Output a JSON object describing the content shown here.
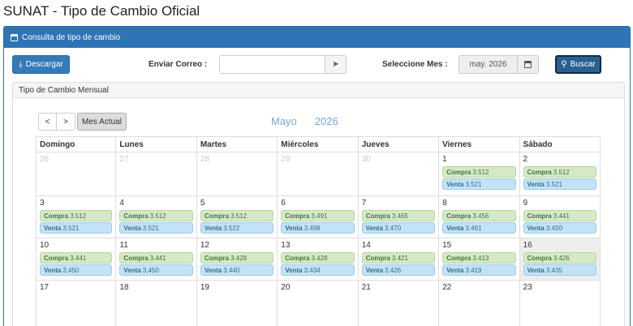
{
  "page_title": "SUNAT - Tipo de Cambio Oficial",
  "panel": {
    "heading": "Consulta de tipo de cambio",
    "icon": "calendar-icon"
  },
  "toolbar": {
    "download_label": "Descargar",
    "email_label": "Enviar Correo :",
    "email_value": "",
    "email_placeholder": "",
    "month_label": "Seleccione Mes :",
    "month_value": "may. 2026",
    "search_label": "Buscar"
  },
  "monthly": {
    "heading": "Tipo de Cambio Mensual",
    "prev_label": "<",
    "next_label": ">",
    "today_label": "Mes Actual",
    "month_name": "Mayo",
    "year": "2026",
    "weekdays": [
      "Domingo",
      "Lunes",
      "Martes",
      "Miércoles",
      "Jueves",
      "Viernes",
      "Sábado"
    ],
    "buy_label": "Compra",
    "sell_label": "Venta",
    "weeks": [
      [
        {
          "day": "26",
          "other": true
        },
        {
          "day": "27",
          "other": true
        },
        {
          "day": "28",
          "other": true
        },
        {
          "day": "29",
          "other": true
        },
        {
          "day": "30",
          "other": true
        },
        {
          "day": "1",
          "buy": "3.512",
          "sell": "3.521"
        },
        {
          "day": "2",
          "buy": "3.512",
          "sell": "3.521"
        }
      ],
      [
        {
          "day": "3",
          "buy": "3.512",
          "sell": "3.521"
        },
        {
          "day": "4",
          "buy": "3.512",
          "sell": "3.521"
        },
        {
          "day": "5",
          "buy": "3.512",
          "sell": "3.522"
        },
        {
          "day": "6",
          "buy": "3.491",
          "sell": "3.498"
        },
        {
          "day": "7",
          "buy": "3.465",
          "sell": "3.470"
        },
        {
          "day": "8",
          "buy": "3.456",
          "sell": "3.461"
        },
        {
          "day": "9",
          "buy": "3.441",
          "sell": "3.450"
        }
      ],
      [
        {
          "day": "10",
          "buy": "3.441",
          "sell": "3.450"
        },
        {
          "day": "11",
          "buy": "3.441",
          "sell": "3.450"
        },
        {
          "day": "12",
          "buy": "3.428",
          "sell": "3.440"
        },
        {
          "day": "13",
          "buy": "3.428",
          "sell": "3.434"
        },
        {
          "day": "14",
          "buy": "3.421",
          "sell": "3.426"
        },
        {
          "day": "15",
          "buy": "3.413",
          "sell": "3.419"
        },
        {
          "day": "16",
          "buy": "3.426",
          "sell": "3.435",
          "today": true
        }
      ],
      [
        {
          "day": "17"
        },
        {
          "day": "18"
        },
        {
          "day": "19"
        },
        {
          "day": "20"
        },
        {
          "day": "21"
        },
        {
          "day": "22"
        },
        {
          "day": "23"
        }
      ]
    ]
  },
  "colors": {
    "panel_header": "#2f75b5",
    "buy_bg": "#d6e9c6",
    "sell_bg": "#c3e2f5",
    "title_accent": "#7aa6d6"
  }
}
